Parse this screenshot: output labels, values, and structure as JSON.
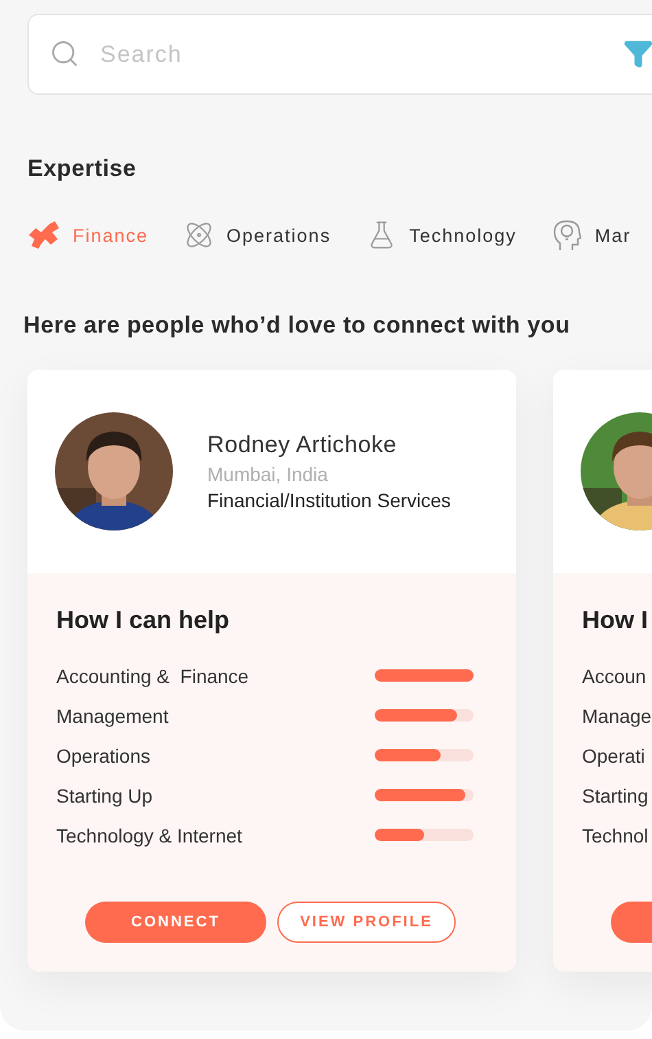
{
  "search": {
    "placeholder": "Search"
  },
  "expertise": {
    "title": "Expertise",
    "categories": [
      {
        "label": "Finance",
        "kind": "finance",
        "selected": true
      },
      {
        "label": "Operations",
        "kind": "operations",
        "selected": false
      },
      {
        "label": "Technology",
        "kind": "technology",
        "selected": false
      },
      {
        "label": "Mar",
        "kind": "management",
        "selected": false
      }
    ]
  },
  "heading": "Here are people who’d love to connect with you",
  "people": [
    {
      "name": "Rodney Artichoke",
      "location": "Mumbai, India",
      "industry": "Financial/Institution Services",
      "help_title": "How I can help",
      "skills": [
        {
          "label": "Accounting &  Finance",
          "level": 1.0
        },
        {
          "label": "Management",
          "level": 0.83
        },
        {
          "label": "Operations",
          "level": 0.67
        },
        {
          "label": "Starting Up",
          "level": 0.92
        },
        {
          "label": "Technology & Internet",
          "level": 0.5
        }
      ],
      "actions": [
        {
          "kind": "primary",
          "label": "CONNECT"
        },
        {
          "kind": "outline",
          "label": "VIEW PROFILE"
        }
      ]
    },
    {
      "help_title": "How I",
      "skills": [
        {
          "label": "Accoun"
        },
        {
          "label": "Manage"
        },
        {
          "label": "Operati"
        },
        {
          "label": "Starting"
        },
        {
          "label": "Technol"
        }
      ],
      "actions": [
        {
          "kind": "primary"
        }
      ]
    }
  ]
}
